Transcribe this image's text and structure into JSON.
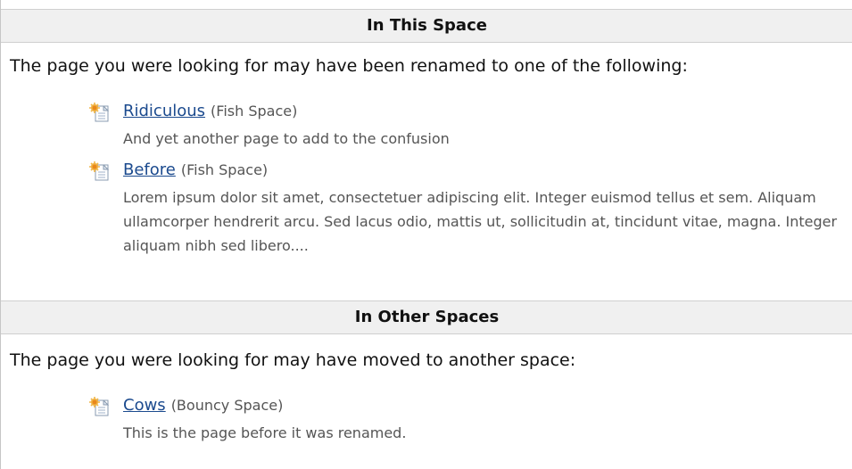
{
  "sections": [
    {
      "header": "In This Space",
      "intro": "The page you were looking for may have been renamed to one of the following:",
      "results": [
        {
          "title": "Ridiculous",
          "space": "(Fish Space)",
          "excerpt": "And yet another page to add to the confusion",
          "icon": "page-icon"
        },
        {
          "title": "Before",
          "space": "(Fish Space)",
          "excerpt": "Lorem ipsum dolor sit amet, consectetuer adipiscing elit. Integer euismod tellus et sem. Aliquam ullamcorper hendrerit arcu. Sed lacus odio, mattis ut, sollicitudin at, tincidunt vitae, magna. Integer aliquam nibh sed libero....",
          "icon": "page-icon"
        }
      ]
    },
    {
      "header": "In Other Spaces",
      "intro": "The page you were looking for may have moved to another space:",
      "results": [
        {
          "title": "Cows",
          "space": "(Bouncy Space)",
          "excerpt": "This is the page before it was renamed.",
          "icon": "page-icon"
        }
      ]
    }
  ],
  "colors": {
    "link": "#1b4a8e",
    "header_bg": "#f0f0f0",
    "muted_text": "#555555"
  }
}
